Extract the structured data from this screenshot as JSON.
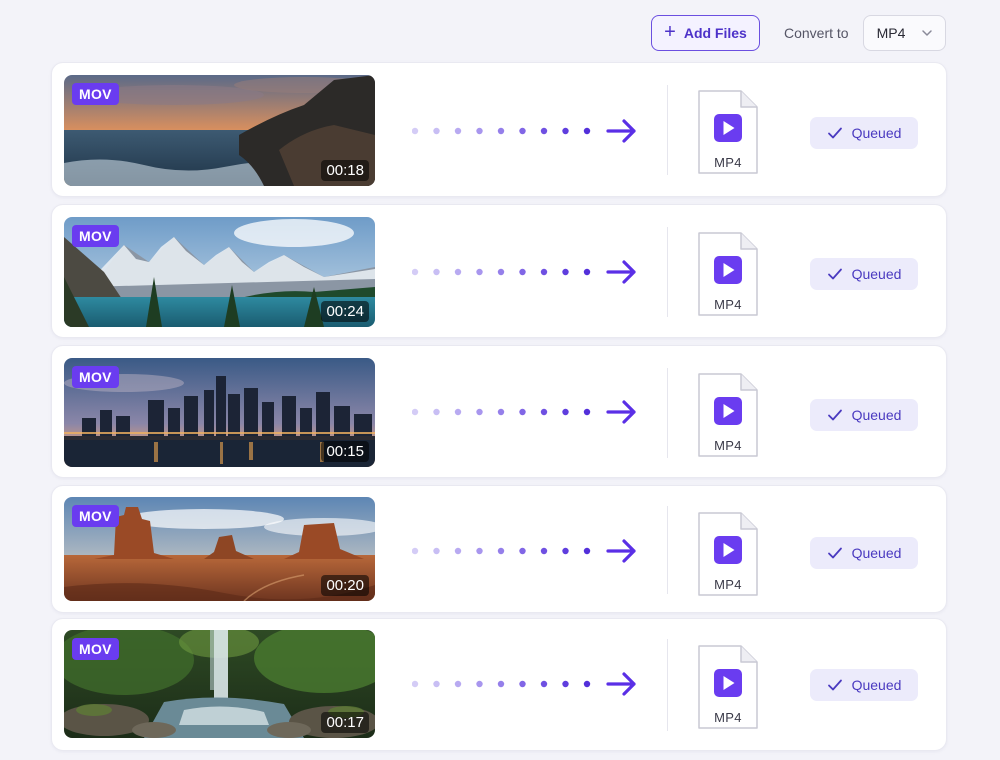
{
  "toolbar": {
    "add_files_label": "Add Files",
    "add_icon": "plus-icon",
    "convert_to_label": "Convert to",
    "format_selected": "MP4",
    "format_icon": "chevron-down-icon"
  },
  "colors": {
    "accent": "#6a3cf0",
    "status_bg": "#ecebfb",
    "page_bg": "#f3f3f9"
  },
  "files": [
    {
      "scene": "ocean sunset",
      "source_format": "MOV",
      "duration": "00:18",
      "target_format": "MP4",
      "status": "Queued"
    },
    {
      "scene": "mountain lake",
      "source_format": "MOV",
      "duration": "00:24",
      "target_format": "MP4",
      "status": "Queued"
    },
    {
      "scene": "city skyline at dusk",
      "source_format": "MOV",
      "duration": "00:15",
      "target_format": "MP4",
      "status": "Queued"
    },
    {
      "scene": "desert buttes",
      "source_format": "MOV",
      "duration": "00:20",
      "target_format": "MP4",
      "status": "Queued"
    },
    {
      "scene": "forest waterfall",
      "source_format": "MOV",
      "duration": "00:17",
      "target_format": "MP4",
      "status": "Queued"
    }
  ]
}
